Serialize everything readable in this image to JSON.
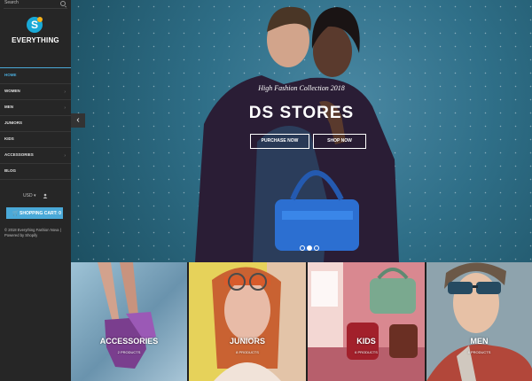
{
  "sidebar": {
    "search_label": "Search",
    "brand": "EVERYTHING",
    "logo_letter": "S",
    "nav": [
      {
        "label": "HOME",
        "active": true,
        "has_arrow": false
      },
      {
        "label": "WOMEN",
        "has_arrow": true
      },
      {
        "label": "MEN",
        "has_arrow": true
      },
      {
        "label": "JUNIORS",
        "has_arrow": false
      },
      {
        "label": "KIDS",
        "has_arrow": false
      },
      {
        "label": "ACCESSORIES",
        "has_arrow": true
      },
      {
        "label": "BLOG",
        "has_arrow": false
      }
    ],
    "currency": "USD",
    "cart_label": "SHOPPING CART: 0",
    "footer_copyright": "© 2018 Everything Fashion Nova |",
    "footer_powered": "Powered by Shopify"
  },
  "hero": {
    "kicker": "High Fashion Collection 2018",
    "title": "DS STORES",
    "button_purchase": "PURCHASE NOW",
    "button_shop": "SHOP NOW",
    "slide_count": 3,
    "active_slide": 2
  },
  "categories": [
    {
      "name": "ACCESSORIES",
      "count": "2 PRODUCTS"
    },
    {
      "name": "JUNIORS",
      "count": "8 PRODUCTS"
    },
    {
      "name": "KIDS",
      "count": "6 PRODUCTS"
    },
    {
      "name": "MEN",
      "count": "8 PRODUCTS"
    }
  ],
  "colors": {
    "accent": "#4aa9d8",
    "sidebar_bg": "#262626",
    "logo_blue": "#19a9d7",
    "logo_yellow": "#f7b21a"
  }
}
